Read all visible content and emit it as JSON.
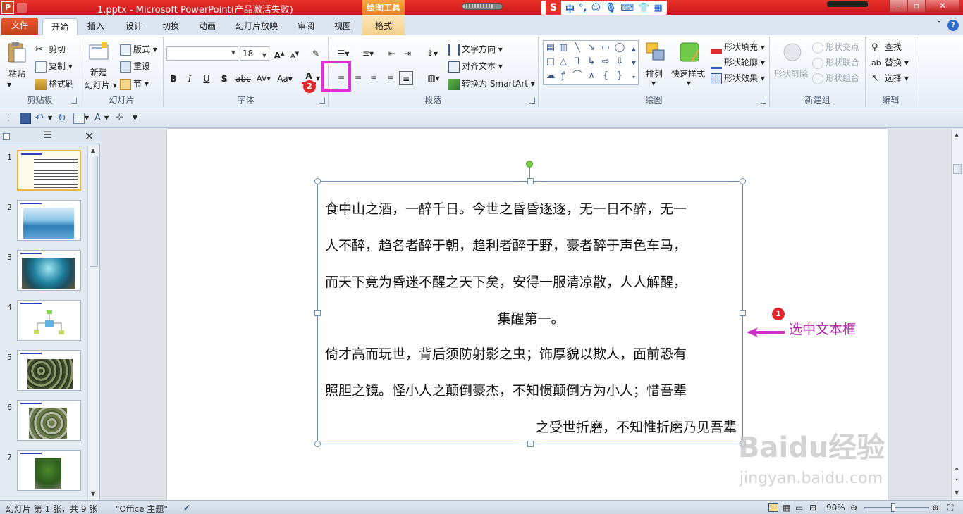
{
  "window": {
    "title": "1.pptx - Microsoft PowerPoint(产品激活失败)",
    "context_tool": "绘图工具",
    "ime": {
      "logo": "S",
      "lang": "中",
      "punct": "°,"
    }
  },
  "tabs": [
    {
      "label": "文件"
    },
    {
      "label": "开始"
    },
    {
      "label": "插入"
    },
    {
      "label": "设计"
    },
    {
      "label": "切换"
    },
    {
      "label": "动画"
    },
    {
      "label": "幻灯片放映"
    },
    {
      "label": "审阅"
    },
    {
      "label": "视图"
    },
    {
      "label": "格式"
    }
  ],
  "ribbon": {
    "clipboard": {
      "label": "剪贴板",
      "paste": "粘贴",
      "cut": "剪切",
      "copy": "复制",
      "format_painter": "格式刷"
    },
    "slides": {
      "label": "幻灯片",
      "new_slide_1": "新建",
      "new_slide_2": "幻灯片",
      "layout": "版式",
      "reset": "重设",
      "section": "节"
    },
    "font": {
      "label": "字体",
      "font_name": "",
      "font_size": "18",
      "bold": "B",
      "italic": "I",
      "underline": "U",
      "shadow": "S",
      "strike": "abc",
      "spacing": "AV",
      "case": "Aa",
      "grow": "A",
      "shrink": "A",
      "color_letter": "A"
    },
    "paragraph": {
      "label": "段落",
      "text_direction": "文字方向",
      "align_text": "对齐文本",
      "smartart": "转换为 SmartArt"
    },
    "drawing": {
      "label": "绘图",
      "arrange": "排列",
      "quick_styles": "快速样式",
      "shape_fill": "形状填充",
      "shape_outline": "形状轮廓",
      "shape_effects": "形状效果"
    },
    "new_group": {
      "label": "新建组",
      "shape_cut": "形状剪除",
      "shape_intersect": "形状交点",
      "shape_union": "形状联合",
      "shape_combine": "形状组合"
    },
    "editing": {
      "label": "编辑",
      "find": "查找",
      "replace": "替换",
      "select": "选择"
    }
  },
  "annotations": {
    "badge1": "1",
    "badge2": "2",
    "callout": "选中文本框"
  },
  "slides": [
    {
      "num": "1"
    },
    {
      "num": "2"
    },
    {
      "num": "3"
    },
    {
      "num": "4"
    },
    {
      "num": "5"
    },
    {
      "num": "6"
    },
    {
      "num": "7"
    }
  ],
  "textbox": {
    "lines": [
      "食中山之酒，一醉千日。今世之昏昏逐逐，无一日不醉，无一",
      "人不醉，趋名者醉于朝，趋利者醉于野，豪者醉于声色车马，",
      "而天下竟为昏迷不醒之天下矣，安得一服清凉散，人人解醒，",
      "集醒第一。",
      "倚才高而玩世，背后须防射影之虫；饰厚貌以欺人，面前恐有",
      "照胆之镜。怪小人之颠倒豪杰，不知惯颠倒方为小人；惜吾辈",
      "之受世折磨，不知惟折磨乃见吾辈"
    ]
  },
  "watermark": {
    "brand": "Baidu经验",
    "url": "jingyan.baidu.com"
  },
  "status": {
    "slide_info": "幻灯片 第 1 张，共 9 张",
    "theme": "\"Office 主题\"",
    "zoom": "90%"
  },
  "colors": {
    "title_bar": "#d4161e",
    "highlight": "#e22fd2",
    "callout": "#b21fa8",
    "badge": "#e3242b"
  }
}
